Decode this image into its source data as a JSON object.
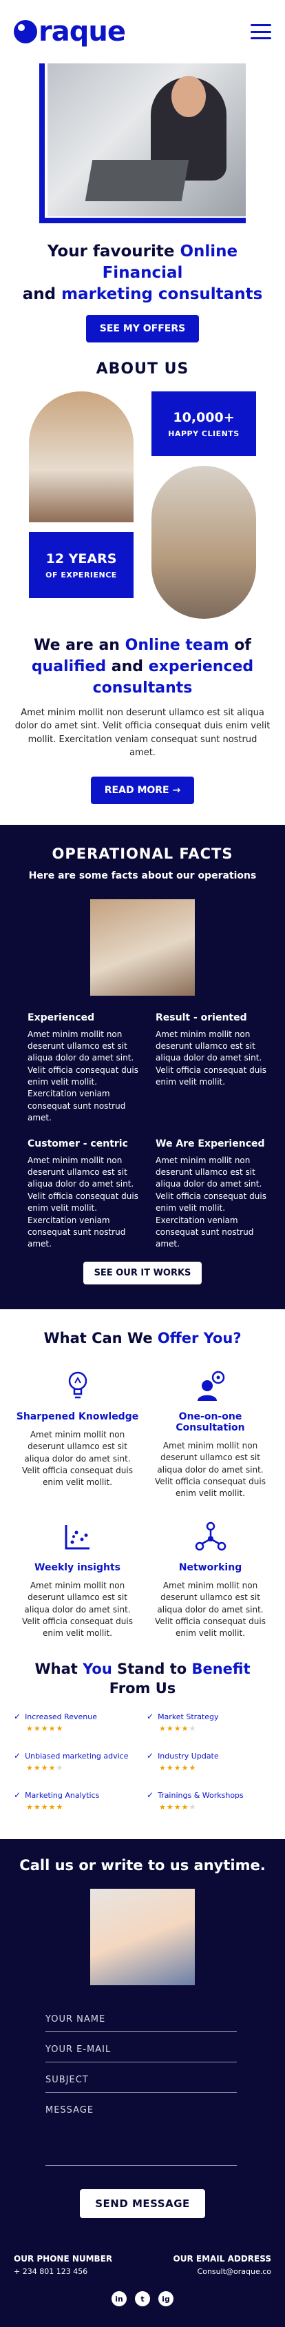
{
  "header": {
    "logo_text": "raque",
    "menu_icon": "hamburger-icon"
  },
  "hero": {
    "title_a": "Your favourite ",
    "title_b": "Online Financial",
    "title_c": " and ",
    "title_d": "marketing consultants",
    "cta": "SEE MY OFFERS"
  },
  "about": {
    "title": "ABOUT US",
    "stat1_value": "10,000+",
    "stat1_label": "HAPPY CLIENTS",
    "stat2_value": "12 YEARS",
    "stat2_label": "OF EXPERIENCE",
    "head_a": "We are an ",
    "head_b": "Online team",
    "head_c": " of ",
    "head_d": "qualified",
    "head_e": " and ",
    "head_f": "experienced consultants",
    "text": "Amet minim mollit non deserunt ullamco est sit aliqua dolor do amet sint. Velit officia consequat duis enim velit mollit. Exercitation veniam consequat sunt nostrud amet.",
    "cta": "READ MORE",
    "cta_icon": "arrow-right-icon"
  },
  "facts": {
    "title": "OPERATIONAL FACTS",
    "subtitle": "Here are some facts about our operations",
    "items": [
      {
        "title": "Experienced",
        "text": "Amet minim mollit non deserunt ullamco est sit aliqua dolor do amet sint. Velit officia consequat duis enim velit mollit. Exercitation veniam consequat sunt nostrud amet."
      },
      {
        "title": "Result - oriented",
        "text": "Amet minim mollit non deserunt ullamco est sit aliqua dolor do amet sint. Velit officia consequat duis enim velit mollit."
      },
      {
        "title": "Customer - centric",
        "text": "Amet minim mollit non deserunt ullamco est sit aliqua dolor do amet sint. Velit officia consequat duis enim velit mollit. Exercitation veniam consequat sunt nostrud amet."
      },
      {
        "title": "We Are Experienced",
        "text": "Amet minim mollit non deserunt ullamco est sit aliqua dolor do amet sint. Velit officia consequat duis enim velit mollit. Exercitation veniam consequat sunt nostrud amet."
      }
    ],
    "cta": "SEE OUR IT WORKS"
  },
  "services": {
    "title_a": "What Can We ",
    "title_b": "Offer You?",
    "items": [
      {
        "icon": "lightbulb-icon",
        "title": "Sharpened Knowledge",
        "text": "Amet minim mollit non deserunt ullamco est sit aliqua dolor do amet sint. Velit officia consequat duis enim velit mollit."
      },
      {
        "icon": "user-consultation-icon",
        "title": "One-on-one Consultation",
        "text": "Amet minim mollit non deserunt ullamco est sit aliqua dolor do amet sint. Velit officia consequat duis enim velit mollit."
      },
      {
        "icon": "chart-insights-icon",
        "title": "Weekly insights",
        "text": "Amet minim mollit non deserunt ullamco est sit aliqua dolor do amet sint. Velit officia consequat duis enim velit mollit."
      },
      {
        "icon": "network-icon",
        "title": "Networking",
        "text": "Amet minim mollit non deserunt ullamco est sit aliqua dolor do amet sint. Velit officia consequat duis enim velit mollit."
      }
    ]
  },
  "benefits": {
    "title_a": "What ",
    "title_b": "You",
    "title_c": " Stand to ",
    "title_d": "Benefit",
    "title_e": " From Us",
    "items": [
      {
        "label": "Increased Revenue",
        "rating": 5
      },
      {
        "label": "Market Strategy",
        "rating": 4
      },
      {
        "label": "Unbiased marketing advice",
        "rating": 4
      },
      {
        "label": "Industry Update",
        "rating": 5
      },
      {
        "label": "Marketing Analytics",
        "rating": 5
      },
      {
        "label": "Trainings & Workshops",
        "rating": 4
      }
    ]
  },
  "contact": {
    "title": "Call us or write to us anytime.",
    "name_placeholder": "YOUR NAME",
    "email_placeholder": "YOUR E-MAIL",
    "subject_placeholder": "SUBJECT",
    "message_placeholder": "MESSAGE",
    "send": "SEND MESSAGE",
    "phone_label": "OUR PHONE NUMBER",
    "phone": "+ 234 801 123 456",
    "email_label": "OUR EMAIL ADDRESS",
    "email": "Consult@oraque.co",
    "socials": [
      "in",
      "t",
      "ig"
    ]
  },
  "colors": {
    "primary": "#0b14c8",
    "dark": "#0b0a36",
    "star": "#f0a000"
  }
}
